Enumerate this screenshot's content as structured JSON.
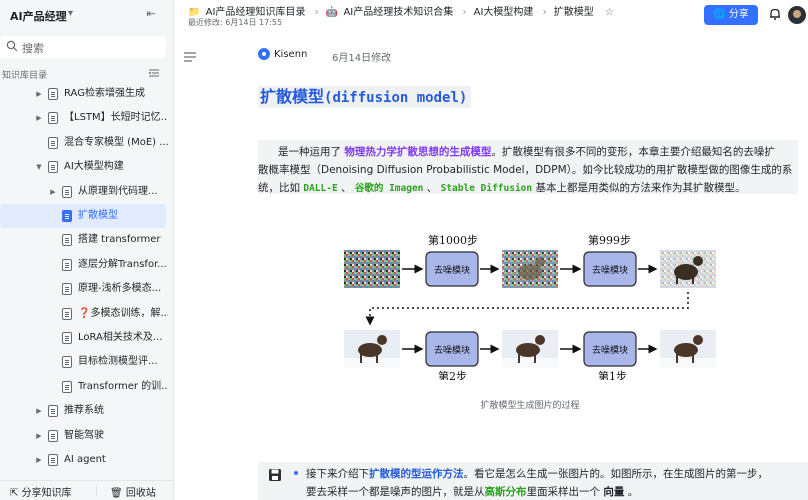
{
  "sidebar": {
    "title": "AI产品经理",
    "search_placeholder": "搜索",
    "section_label": "知识库目录",
    "items": [
      {
        "label": "RAG检索增强生成",
        "level": 1,
        "caret": true
      },
      {
        "label": "【LSTM】长短时记忆...",
        "level": 1,
        "caret": true
      },
      {
        "label": "混合专家模型 (MoE) ...",
        "level": 1,
        "caret": false
      },
      {
        "label": "AI大模型构建",
        "level": 1,
        "caret": true,
        "expanded": true
      },
      {
        "label": "从原理到代码理...",
        "level": 2,
        "caret": true
      },
      {
        "label": "扩散模型",
        "level": 2,
        "caret": false,
        "active": true
      },
      {
        "label": "搭建 transformer",
        "level": 2,
        "caret": false
      },
      {
        "label": "逐层分解Transfor...",
        "level": 2,
        "caret": false
      },
      {
        "label": "原理-浅析多模态...",
        "level": 2,
        "caret": false
      },
      {
        "label": "❓多模态训练，解...",
        "level": 2,
        "caret": false
      },
      {
        "label": "LoRA相关技术及...",
        "level": 2,
        "caret": false
      },
      {
        "label": "目标检测模型评...",
        "level": 2,
        "caret": false
      },
      {
        "label": "Transformer 的训...",
        "level": 2,
        "caret": false
      },
      {
        "label": "推荐系统",
        "level": 1,
        "caret": true
      },
      {
        "label": "智能驾驶",
        "level": 1,
        "caret": true
      },
      {
        "label": "AI agent",
        "level": 1,
        "caret": true
      }
    ],
    "footer": {
      "share": "分享知识库",
      "trash": "回收站"
    }
  },
  "header": {
    "breadcrumbs": [
      "AI产品经理知识库目录",
      "AI产品经理技术知识合集",
      "AI大模型构建",
      "扩散模型"
    ],
    "modified": "最近修改: 6月14日 17:55",
    "share_label": "分享"
  },
  "doc": {
    "author": "Kisenn",
    "date": "6月14日修改",
    "title_cn": "扩散模型",
    "title_en": "(diffusion model)",
    "para": {
      "l1_a": "是一种运用了",
      "l1_hl": "物理热力学扩散思想的生成模型",
      "l1_b": "。扩散模型有很多不同的变形，本章主要介绍最知名的去噪扩",
      "l2": "散概率模型（Denoising Diffusion Probabilistic Model，DDPM）。如今比较成功的用扩散模型做的图像生成的系",
      "l3_a": "统，比如",
      "l3_c1": "DALL-E",
      "l3_sep1": "、",
      "l3_c2": "谷歌的 Imagen",
      "l3_sep2": "、",
      "l3_c3": "Stable Diffusion",
      "l3_b": "基本上都是用类似的方法来作为其扩散模型。"
    },
    "figure": {
      "step_top_left": "第1000步",
      "step_top_right": "第999步",
      "step_bottom_left": "第2步",
      "step_bottom_right": "第1步",
      "module_label": "去噪模块",
      "caption": "扩散模型生成图片的过程"
    },
    "callout": {
      "l1_a": "接下来介绍下",
      "l1_hl": "扩散模的型运作方法",
      "l1_b": "。看它是怎么生成一张图片的。如图所示，在生成图片的第一步，",
      "l2_a": "要去采样一个都是噪声的图片，就是从",
      "l2_hl": "高斯分布",
      "l2_b": "里面采样出一个",
      "l2_bold": "向量",
      "l2_c": "。"
    }
  },
  "colors": {
    "accent": "#3370ff",
    "title": "#245bdb",
    "purple": "#7f3bf5",
    "green": "#2ea121",
    "module_fill": "#a9b6ea"
  }
}
